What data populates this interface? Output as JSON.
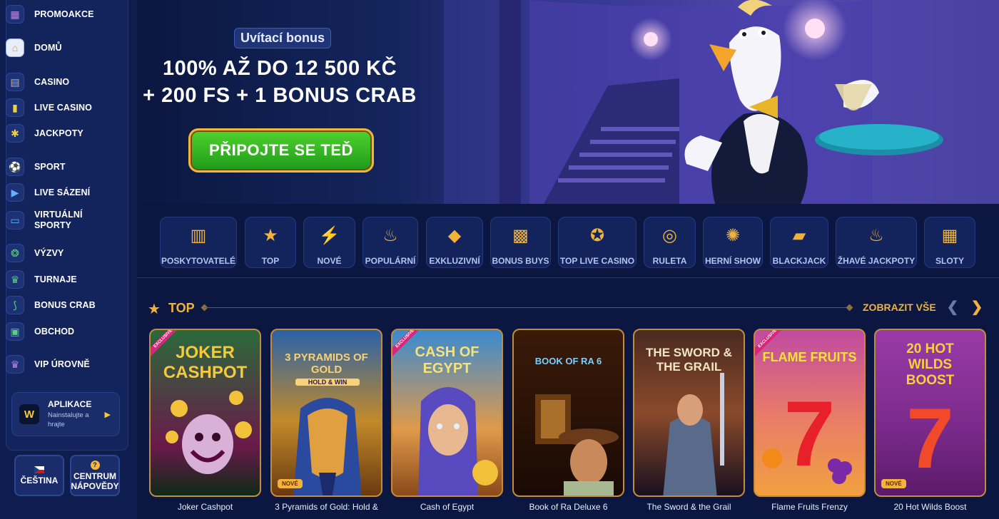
{
  "sidebar": {
    "items": [
      {
        "label": "PROMOAKCE",
        "icon": "gift-icon"
      },
      {
        "label": "DOMŮ",
        "icon": "home-icon"
      },
      {
        "label": "CASINO",
        "icon": "slot-machine-icon"
      },
      {
        "label": "LIVE CASINO",
        "icon": "card-dealer-icon"
      },
      {
        "label": "JACKPOTY",
        "icon": "jackpot-icon"
      },
      {
        "label": "SPORT",
        "icon": "football-icon"
      },
      {
        "label": "LIVE SÁZENÍ",
        "icon": "play-icon"
      },
      {
        "label": "VIRTUÁLNÍ SPORTY",
        "icon": "virtual-sports-icon"
      },
      {
        "label": "VÝZVY",
        "icon": "challenge-icon"
      },
      {
        "label": "TURNAJE",
        "icon": "trophy-icon"
      },
      {
        "label": "BONUS CRAB",
        "icon": "claw-icon"
      },
      {
        "label": "OBCHOD",
        "icon": "shop-bag-icon"
      },
      {
        "label": "VIP ÚROVNĚ",
        "icon": "crown-icon"
      }
    ],
    "app_card": {
      "title": "APLIKACE",
      "subtitle_1": "Nainstalujte a",
      "subtitle_2": "hrajte",
      "logo": "W"
    },
    "language_label": "ČEŠTINA",
    "help_label_1": "CENTRUM",
    "help_label_2": "NÁPOVĚDY"
  },
  "hero": {
    "tag": "Uvítací bonus",
    "line1": "100% AŽ DO 12 500 KČ",
    "line2": "+ 200 FS + 1 BONUS CRAB",
    "cta": "PŘIPOJTE SE TEĎ"
  },
  "categories": [
    {
      "label": "POSKYTOVATELÉ",
      "icon": "book-icon"
    },
    {
      "label": "TOP",
      "icon": "star-icon"
    },
    {
      "label": "NOVÉ",
      "icon": "lightning-icon"
    },
    {
      "label": "POPULÁRNÍ",
      "icon": "fire-icon"
    },
    {
      "label": "EXKLUZIVNÍ",
      "icon": "diamond-icon"
    },
    {
      "label": "BONUS BUYS",
      "icon": "gift-icon"
    },
    {
      "label": "TOP LIVE CASINO",
      "icon": "medal-icon"
    },
    {
      "label": "RULETA",
      "icon": "roulette-icon"
    },
    {
      "label": "HERNÍ SHOW",
      "icon": "wheel-icon"
    },
    {
      "label": "BLACKJACK",
      "icon": "cards-icon"
    },
    {
      "label": "ŽHAVÉ JACKPOTY",
      "icon": "hot-jackpot-icon"
    },
    {
      "label": "SLOTY",
      "icon": "slots-icon"
    }
  ],
  "section": {
    "title": "TOP",
    "show_all": "ZOBRAZIT VŠE"
  },
  "games": [
    {
      "name": "Joker Cashpot",
      "art": "JOKER CASHPOT",
      "badge_excl": "EXCLUSIVE",
      "badge_new": "",
      "colors": [
        "#2a6a3a",
        "#0e2a18"
      ]
    },
    {
      "name": "3 Pyramids of Gold: Hold &",
      "art": "3 PYRAMIDS OF GOLD",
      "art_sub": "HOLD & WIN",
      "badge_excl": "",
      "badge_new": "NOVÉ",
      "colors": [
        "#2a62a8",
        "#6a3a10"
      ]
    },
    {
      "name": "Cash of Egypt",
      "art": "CASH OF EGYPT",
      "badge_excl": "EXCLUSIVE",
      "badge_new": "",
      "colors": [
        "#3a8ad0",
        "#8a4a1a"
      ]
    },
    {
      "name": "Book of Ra Deluxe 6",
      "art": "BOOK OF RA 6",
      "badge_excl": "",
      "badge_new": "",
      "colors": [
        "#3a1a08",
        "#120804"
      ]
    },
    {
      "name": "The Sword & the Grail",
      "art": "THE SWORD & THE GRAIL",
      "badge_excl": "",
      "badge_new": "",
      "colors": [
        "#4a2a22",
        "#1a1020"
      ]
    },
    {
      "name": "Flame Fruits Frenzy",
      "art": "FLAME FRUITS",
      "badge_excl": "EXCLUSIVE",
      "badge_new": "",
      "colors": [
        "#c04aa0",
        "#f2a040"
      ]
    },
    {
      "name": "20 Hot Wilds Boost",
      "art": "20 HOT WILDS BOOST",
      "badge_excl": "",
      "badge_new": "NOVÉ",
      "colors": [
        "#9a3aa8",
        "#5a1a6a"
      ]
    }
  ],
  "colors": {
    "accent": "#f1b23c",
    "cta_green": "#2fb81f",
    "bg": "#0b1740"
  }
}
